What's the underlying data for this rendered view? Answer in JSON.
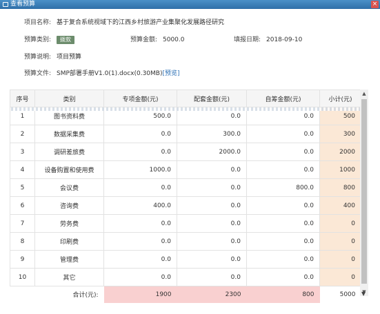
{
  "window": {
    "title": "查看预算"
  },
  "info": {
    "project_label": "项目名称:",
    "project_value": "基于复合系统视域下的江西乡村旅游产业集聚化发展路径研究",
    "type_label": "预算类别:",
    "type_value": "拨款",
    "amount_label": "预算金额:",
    "amount_value": "5000.0",
    "date_label": "填报日期:",
    "date_value": "2018-09-10",
    "desc_label": "预算说明:",
    "desc_value": "项目预算",
    "file_label": "预算文件:",
    "file_value": "SMP部署手册V1.0(1).docx(0.30MB)",
    "preview_label": "[预览]"
  },
  "table": {
    "headers": [
      "序号",
      "类别",
      "专项金额(元)",
      "配套金额(元)",
      "自筹金额(元)",
      "小计(元)"
    ],
    "rows": [
      {
        "no": "1",
        "cat": "图书资料费",
        "special": "500.0",
        "match": "0.0",
        "self": "0.0",
        "sub": "500"
      },
      {
        "no": "2",
        "cat": "数据采集费",
        "special": "0.0",
        "match": "300.0",
        "self": "0.0",
        "sub": "300"
      },
      {
        "no": "3",
        "cat": "调研差旅费",
        "special": "0.0",
        "match": "2000.0",
        "self": "0.0",
        "sub": "2000"
      },
      {
        "no": "4",
        "cat": "设备购置和使用费",
        "special": "1000.0",
        "match": "0.0",
        "self": "0.0",
        "sub": "1000"
      },
      {
        "no": "5",
        "cat": "会议费",
        "special": "0.0",
        "match": "0.0",
        "self": "800.0",
        "sub": "800"
      },
      {
        "no": "6",
        "cat": "咨询费",
        "special": "400.0",
        "match": "0.0",
        "self": "0.0",
        "sub": "400"
      },
      {
        "no": "7",
        "cat": "劳务费",
        "special": "0.0",
        "match": "0.0",
        "self": "0.0",
        "sub": "0"
      },
      {
        "no": "8",
        "cat": "印刷费",
        "special": "0.0",
        "match": "0.0",
        "self": "0.0",
        "sub": "0"
      },
      {
        "no": "9",
        "cat": "管理费",
        "special": "0.0",
        "match": "0.0",
        "self": "0.0",
        "sub": "0"
      },
      {
        "no": "10",
        "cat": "其它",
        "special": "0.0",
        "match": "0.0",
        "self": "0.0",
        "sub": "0"
      }
    ],
    "total": {
      "label": "合计(元):",
      "special": "1900",
      "match": "2300",
      "self": "800",
      "sub": "5000"
    }
  },
  "icons": {
    "close": "close-icon",
    "window": "window-icon",
    "dropdown": "chevron-down-icon"
  }
}
